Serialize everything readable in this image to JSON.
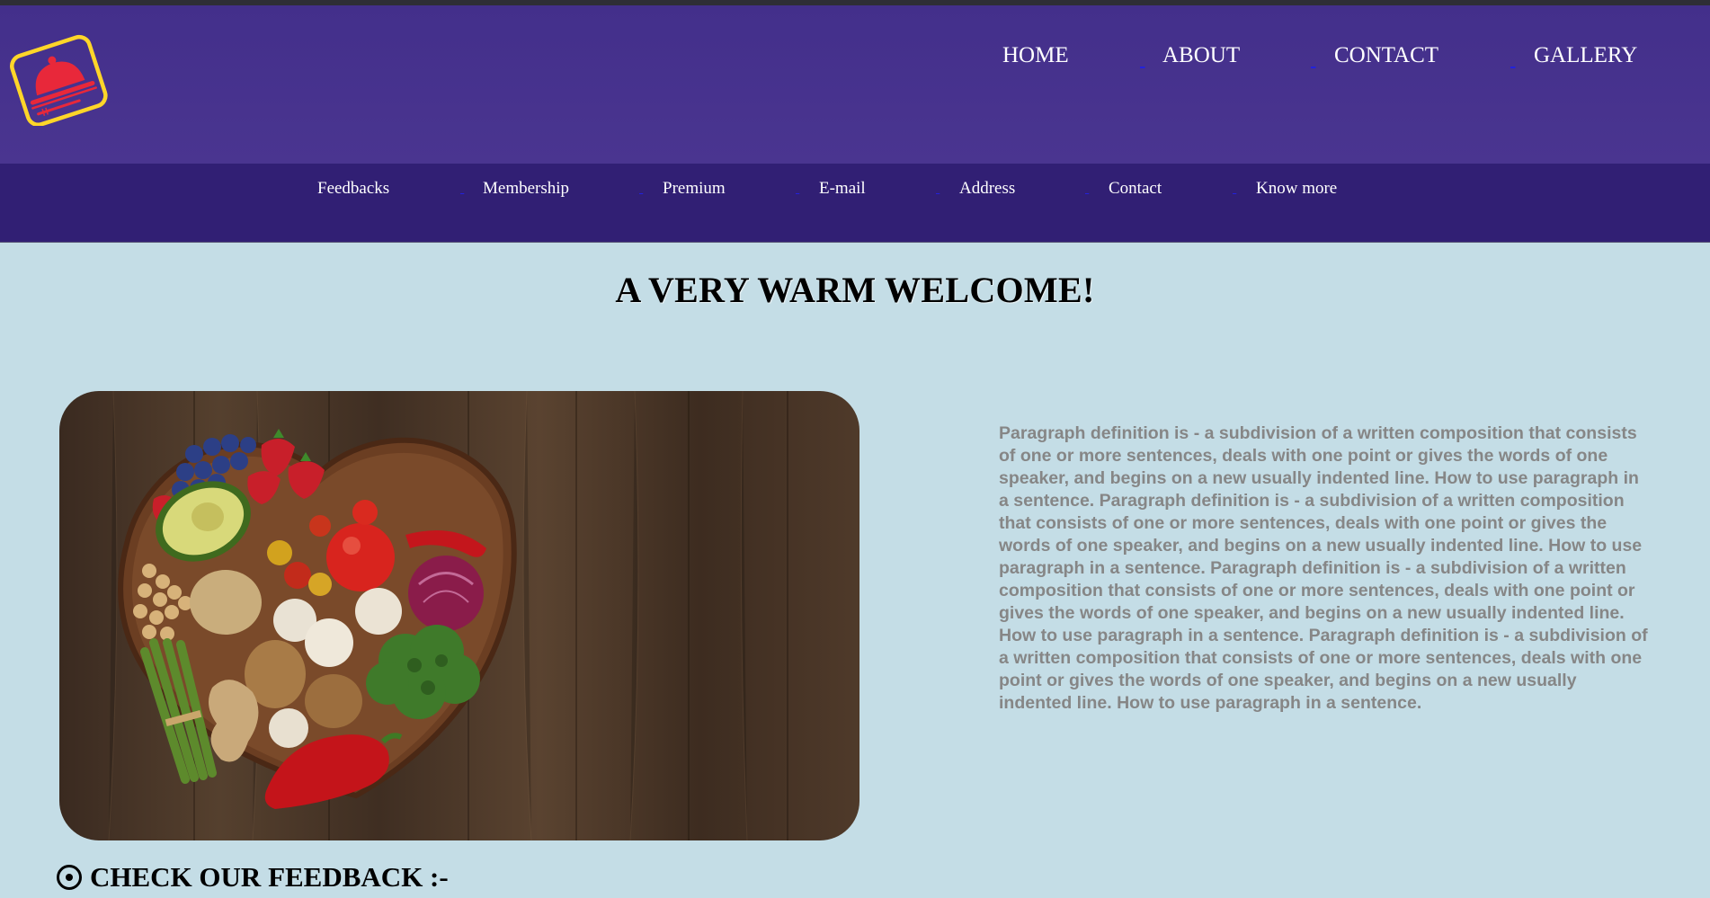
{
  "header": {
    "logo_icon": "cloche-icon",
    "nav": [
      {
        "label": "HOME"
      },
      {
        "label": "ABOUT"
      },
      {
        "label": "CONTACT"
      },
      {
        "label": "GALLERY"
      }
    ]
  },
  "subnav": {
    "items": [
      {
        "label": "Feedbacks"
      },
      {
        "label": "Membership"
      },
      {
        "label": "Premium"
      },
      {
        "label": "E-mail"
      },
      {
        "label": "Address"
      },
      {
        "label": "Contact"
      },
      {
        "label": "Know more"
      }
    ]
  },
  "main": {
    "welcome_title": "A VERY WARM WELCOME!",
    "paragraph": "Paragraph definition is - a subdivision of a written composition that consists of one or more sentences, deals with one point or gives the words of one speaker, and begins on a new usually indented line. How to use paragraph in a sentence. Paragraph definition is - a subdivision of a written composition that consists of one or more sentences, deals with one point or gives the words of one speaker, and begins on a new usually indented line. How to use paragraph in a sentence. Paragraph definition is - a subdivision of a written composition that consists of one or more sentences, deals with one point or gives the words of one speaker, and begins on a new usually indented line. How to use paragraph in a sentence. Paragraph definition is - a subdivision of a written composition that consists of one or more sentences, deals with one point or gives the words of one speaker, and begins on a new usually indented line. How to use paragraph in a sentence.",
    "feedback_heading": "CHECK OUR FEEDBACK :-",
    "feedback_icon": "radio-target-icon"
  },
  "colors": {
    "header_bg": "#432f8b",
    "subnav_bg": "#311f74",
    "page_bg": "#c4dde6",
    "logo_red": "#e8283a",
    "logo_yellow": "#ffd629",
    "paragraph_text": "#868686"
  }
}
